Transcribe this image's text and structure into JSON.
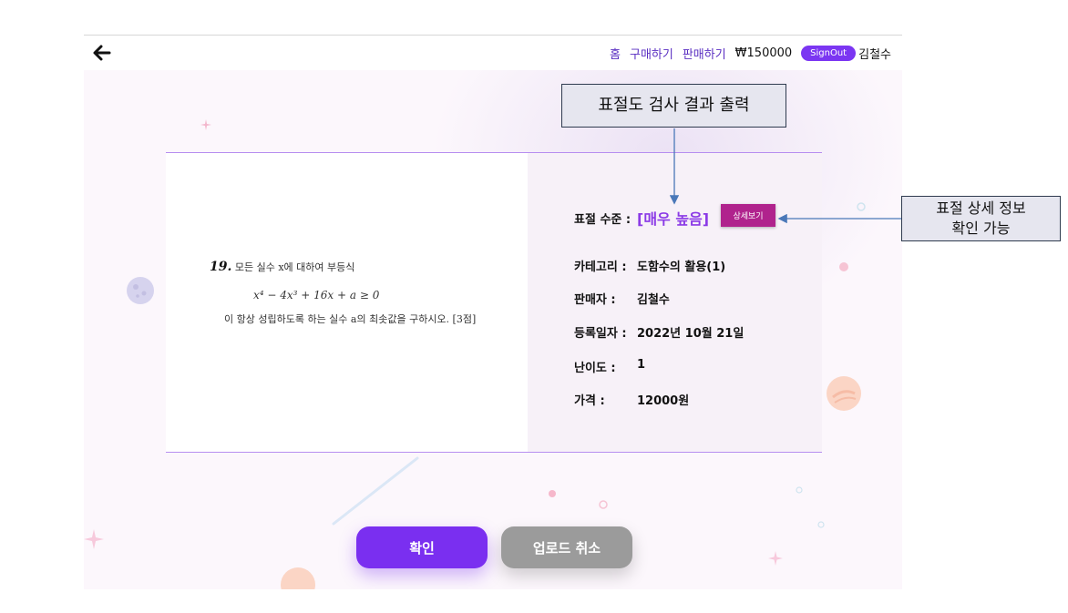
{
  "navbar": {
    "home": "홈",
    "buy": "구매하기",
    "sell": "판매하기",
    "balance": "₩150000",
    "signout": "SignOut",
    "user": "김철수"
  },
  "problem": {
    "number": "19.",
    "line1": "모든 실수 x에 대하여 부등식",
    "line2": "x⁴ − 4x³ + 16x + a ≥ 0",
    "line3": "이 항상 성립하도록 하는 실수 a의 최솟값을 구하시오. [3점]"
  },
  "info": {
    "level_label": "표절 수준 :",
    "level_value": "[매우 높음]",
    "detail_button": "상세보기",
    "category_label": "카테고리 :",
    "category_value": "도함수의 활용(1)",
    "seller_label": "판매자 :",
    "seller_value": "김철수",
    "date_label": "등록일자 :",
    "date_value": "2022년 10월 21일",
    "difficulty_label": "난이도 :",
    "difficulty_value": "1",
    "price_label": "가격 :",
    "price_value": "12000원"
  },
  "actions": {
    "confirm": "확인",
    "cancel": "업로드 취소"
  },
  "annotations": {
    "result_output": "표절도 검사 결과 출력",
    "detail_line1": "표절 상세 정보",
    "detail_line2": "확인 가능"
  },
  "icons": {
    "back": "back-arrow-icon"
  },
  "colors": {
    "accent": "#7a2ff0",
    "level": "#8b3ae6",
    "detail_button": "#b0238d",
    "cancel_button": "#9b9b9b"
  }
}
